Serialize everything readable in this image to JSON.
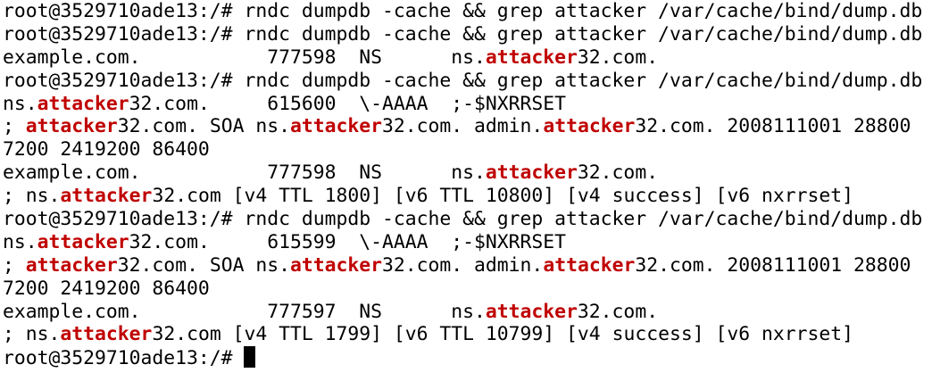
{
  "terminal": {
    "highlight_term": "attacker",
    "highlight_color": "#c00000",
    "background_color": "#ffffff",
    "text_color": "#000000",
    "lines": [
      "root@3529710ade13:/# rndc dumpdb -cache && grep attacker /var/cache/bind/dump.db",
      "root@3529710ade13:/# rndc dumpdb -cache && grep attacker /var/cache/bind/dump.db",
      "example.com.           777598  NS      ns.attacker32.com.",
      "root@3529710ade13:/# rndc dumpdb -cache && grep attacker /var/cache/bind/dump.db",
      "ns.attacker32.com.     615600  \\-AAAA  ;-$NXRRSET",
      "; attacker32.com. SOA ns.attacker32.com. admin.attacker32.com. 2008111001 28800",
      "7200 2419200 86400",
      "example.com.           777598  NS      ns.attacker32.com.",
      "; ns.attacker32.com [v4 TTL 1800] [v6 TTL 10800] [v4 success] [v6 nxrrset]",
      "root@3529710ade13:/# rndc dumpdb -cache && grep attacker /var/cache/bind/dump.db",
      "ns.attacker32.com.     615599  \\-AAAA  ;-$NXRRSET",
      "; attacker32.com. SOA ns.attacker32.com. admin.attacker32.com. 2008111001 28800",
      "7200 2419200 86400",
      "example.com.           777597  NS      ns.attacker32.com.",
      "; ns.attacker32.com [v4 TTL 1799] [v6 TTL 10799] [v4 success] [v6 nxrrset]",
      "root@3529710ade13:/# "
    ]
  }
}
